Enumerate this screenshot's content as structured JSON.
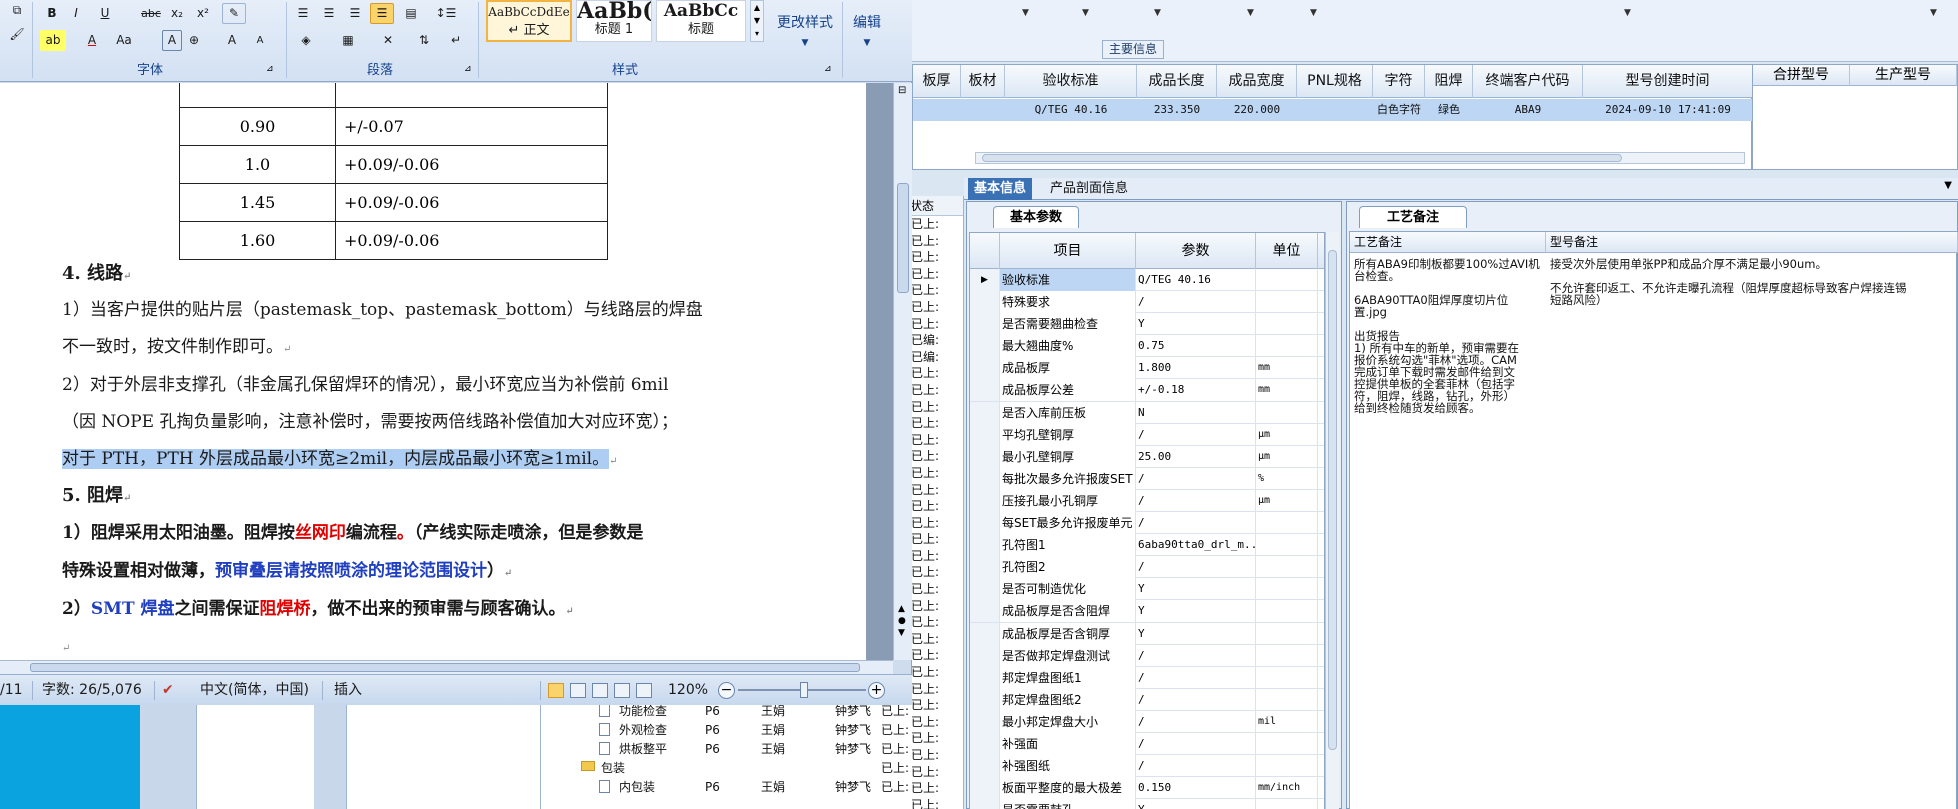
{
  "erp": {
    "main_info_label": "主要信息",
    "top_grid_columns": [
      "板厚",
      "板材",
      "验收标准",
      "成品长度",
      "成品宽度",
      "PNL规格",
      "字符",
      "阻焊",
      "终端客户代码",
      "型号创建时间"
    ],
    "top_grid_row": [
      "",
      "",
      "Q/TEG 40.16",
      "233.350",
      "220.000",
      "",
      "白色字符",
      "绿色",
      "ABA9",
      "2024-09-10 17:41:09"
    ],
    "merge_columns": [
      "合拼型号",
      "生产型号"
    ],
    "status_header": "状态",
    "status_values": [
      "已上:",
      "已上:",
      "已上:",
      "已上:",
      "已上:",
      "已上:",
      "已上:",
      "已编:",
      "已编:",
      "已上:",
      "已上:",
      "已上:",
      "已上:",
      "已上:",
      "已上:",
      "已上:",
      "已上:",
      "已上:",
      "已上:",
      "已上:",
      "已上:",
      "已上:",
      "已上:",
      "已上:",
      "已上:",
      "已上:",
      "已上:",
      "已上:",
      "已上:",
      "已上:",
      "已上:",
      "已上:",
      "已上:",
      "已上:",
      "已上:",
      "已上:"
    ],
    "tabs": [
      "基本信息",
      "产品剖面信息"
    ],
    "param_subtab": "基本参数",
    "param_columns": [
      "项目",
      "参数",
      "单位"
    ],
    "params": [
      {
        "item": "验收标准",
        "param": "Q/TEG 40.16",
        "unit": ""
      },
      {
        "item": "特殊要求",
        "param": "/",
        "unit": ""
      },
      {
        "item": "是否需要翘曲检查",
        "param": "Y",
        "unit": ""
      },
      {
        "item": "最大翘曲度%",
        "param": "0.75",
        "unit": ""
      },
      {
        "item": "成品板厚",
        "param": "1.800",
        "unit": "mm"
      },
      {
        "item": "成品板厚公差",
        "param": "+/-0.18",
        "unit": "mm"
      },
      {
        "item": "是否入库前压板",
        "param": "N",
        "unit": ""
      },
      {
        "item": "平均孔壁铜厚",
        "param": "/",
        "unit": "μm"
      },
      {
        "item": "最小孔壁铜厚",
        "param": "25.00",
        "unit": "μm"
      },
      {
        "item": "每批次最多允许报废SET",
        "param": "/",
        "unit": "%"
      },
      {
        "item": "压接孔最小孔铜厚",
        "param": "/",
        "unit": "μm"
      },
      {
        "item": "每SET最多允许报废单元",
        "param": "/",
        "unit": ""
      },
      {
        "item": "孔符图1",
        "param": "6aba90tta0_drl_m...",
        "unit": ""
      },
      {
        "item": "孔符图2",
        "param": "/",
        "unit": ""
      },
      {
        "item": "是否可制造优化",
        "param": "Y",
        "unit": ""
      },
      {
        "item": "成品板厚是否含阻焊",
        "param": "Y",
        "unit": ""
      },
      {
        "item": "成品板厚是否含铜厚",
        "param": "Y",
        "unit": ""
      },
      {
        "item": "是否做邦定焊盘测试",
        "param": "/",
        "unit": ""
      },
      {
        "item": "邦定焊盘图纸1",
        "param": "/",
        "unit": ""
      },
      {
        "item": "邦定焊盘图纸2",
        "param": "/",
        "unit": ""
      },
      {
        "item": "最小邦定焊盘大小",
        "param": "/",
        "unit": "mil"
      },
      {
        "item": "补强面",
        "param": "/",
        "unit": ""
      },
      {
        "item": "补强图纸",
        "param": "/",
        "unit": ""
      },
      {
        "item": "板面平整度的最大极差",
        "param": "0.150",
        "unit": "mm/inch"
      },
      {
        "item": "是否需要鼓孔",
        "param": "Y",
        "unit": ""
      }
    ],
    "craft_tab": "工艺备注",
    "craft_header_1": "工艺备注",
    "craft_header_2": "型号备注",
    "craft_text_1": "所有ABA9印制板都要100%过AVI机\n台检查。\n\n6ABA90TTA0阻焊厚度切片位\n置.jpg\n\n出货报告\n1) 所有中车的新单，预审需要在\n报价系统勾选\"菲林\"选项。CAM\n完成订单下载时需发邮件给到文\n控提供单板的全套菲林（包括字\n符，阻焊，线路，钻孔，外形）\n给到终检随货发给顾客。",
    "craft_text_2": "接受次外层使用单张PP和成品介厚不满足最小90um。\n\n不允许套印返工、不允许走曝孔流程（阻焊厚度超标导致客户焊接连锡\n短路风险）",
    "tree": [
      {
        "name": "功能检查",
        "code": "P6",
        "person": "王娟",
        "person2": "钟梦飞",
        "status": "已上:"
      },
      {
        "name": "外观检查",
        "code": "P6",
        "person": "王娟",
        "person2": "钟梦飞",
        "status": "已上:"
      },
      {
        "name": "烘板整平",
        "code": "P6",
        "person": "王娟",
        "person2": "钟梦飞",
        "status": "已上:"
      },
      {
        "name": "包装",
        "code": "",
        "person": "",
        "person2": "",
        "status": "已上:"
      },
      {
        "name": "内包装",
        "code": "P6",
        "person": "王娟",
        "person2": "钟梦飞",
        "status": "已上:"
      }
    ]
  },
  "word": {
    "ribbon": {
      "font_group": "字体",
      "paragraph_group": "段落",
      "styles_group": "样式",
      "styles": [
        {
          "preview": "AaBbCcDdEe",
          "name": "↵ 正文"
        },
        {
          "preview": "AaBb(",
          "name": "标题 1"
        },
        {
          "preview": "AaBbCc",
          "name": "标题"
        }
      ],
      "change_styles": "更改样式",
      "edit": "编辑",
      "font_buttons": [
        "B",
        "I",
        "U",
        "abc",
        "x₂",
        "x²",
        "A",
        "A",
        "Aa",
        "A",
        "A",
        "A"
      ]
    },
    "table_rows": [
      {
        "c1": "0.90",
        "c2": "+/-0.07"
      },
      {
        "c1": "1.0",
        "c2": "+0.09/-0.06"
      },
      {
        "c1": "1.45",
        "c2": "+0.09/-0.06"
      },
      {
        "c1": "1.60",
        "c2": "+0.09/-0.06"
      }
    ],
    "para_4_title": "4. 线路",
    "para_4_1a": "1）当客户提供的贴片层（pastemask_top、pastemask_bottom）与线路层的焊盘",
    "para_4_1b": "不一致时，按文件制作即可。",
    "para_4_2a": "2）对于外层非支撑孔（非金属孔保留焊环的情况），最小环宽应当为补偿前 6mil",
    "para_4_2b": "（因 NOPE 孔掏负量影响，注意补偿时，需要按两倍线路补偿值加大对应环宽）；",
    "para_4_2c": "对于 PTH，PTH 外层成品最小环宽≥2mil，内层成品最小环宽≥1mil。",
    "para_5_title": "5. 阻焊",
    "para_5_1a_1": "1）阻焊采用太阳油墨。阻焊按",
    "para_5_1a_2": "丝网印",
    "para_5_1a_3": "编流程",
    "para_5_1a_4": "。",
    "para_5_1a_5": "（产线实际走喷涂，但是参数是",
    "para_5_1b_1": "特殊设置相对做薄，",
    "para_5_1b_2": "预审叠层请按照喷涂的理论范围设计",
    "para_5_1b_3": "）",
    "para_5_2_1": "2）",
    "para_5_2_2": "SMT 焊盘",
    "para_5_2_3": "之间需保证",
    "para_5_2_4": "阻焊桥",
    "para_5_2_5": "，做不出来的预审需与顾客确认。",
    "status": {
      "page": "/11",
      "word_count": "字数: 26/5,076",
      "language": "中文(简体，中国)",
      "mode": "插入",
      "zoom": "120%"
    }
  }
}
